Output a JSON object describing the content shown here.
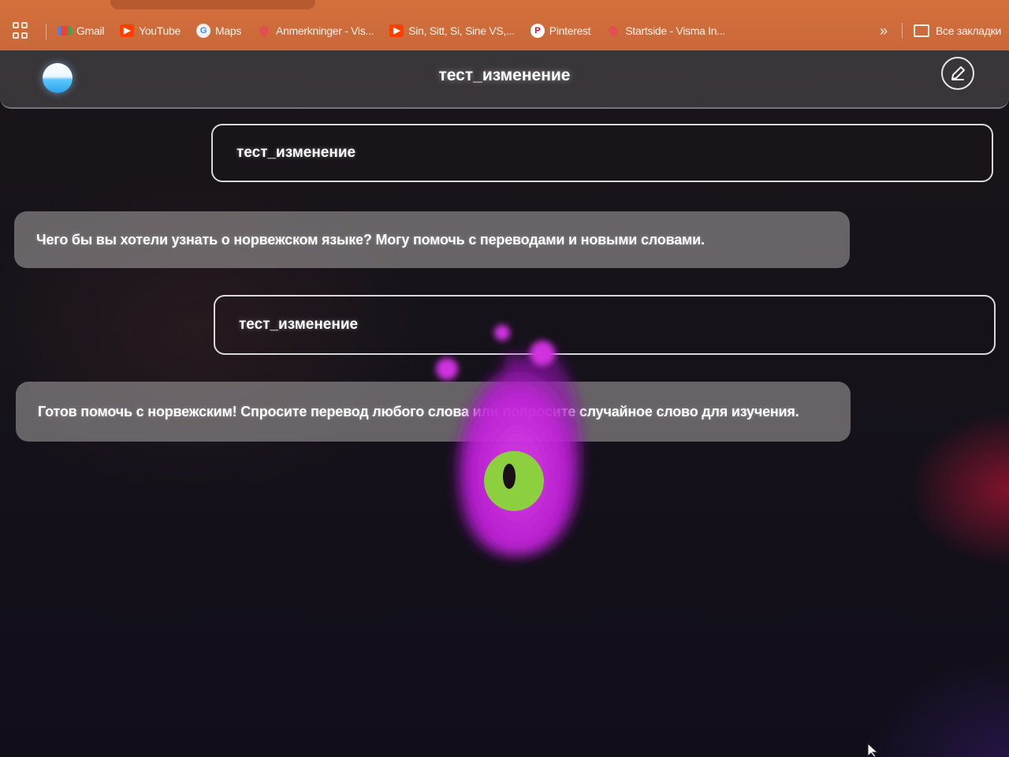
{
  "bookmarks": {
    "items": [
      {
        "label": "Gmail",
        "icon": "gmail-icon"
      },
      {
        "label": "YouTube",
        "icon": "youtube-icon"
      },
      {
        "label": "Maps",
        "icon": "google-icon"
      },
      {
        "label": "Anmerkninger - Vis...",
        "icon": "bookmark-favicon"
      },
      {
        "label": "Sin, Sitt, Si, Sine VS,...",
        "icon": "youtube-icon"
      },
      {
        "label": "Pinterest",
        "icon": "pinterest-icon"
      },
      {
        "label": "Startside - Visma In...",
        "icon": "bookmark-favicon"
      }
    ],
    "more_label": "»",
    "all_bookmarks_label": "Все закладки"
  },
  "header": {
    "title": "тест_изменение"
  },
  "chat": {
    "messages": [
      {
        "role": "user",
        "text": "тест_изменение"
      },
      {
        "role": "bot",
        "text": "Чего бы вы хотели узнать о норвежском языке? Могу помочь с переводами и новыми словами."
      },
      {
        "role": "user",
        "text": "тест_изменение"
      },
      {
        "role": "bot",
        "text": "Готов помочь с норвежским! Спросите перевод любого слова или попросите случайное слово для изучения."
      }
    ]
  },
  "colors": {
    "bookmarks_bar": "#c9683a",
    "background": "#15121a",
    "mascot_glow": "#d020e0",
    "mascot_eye": "#8cd040"
  }
}
